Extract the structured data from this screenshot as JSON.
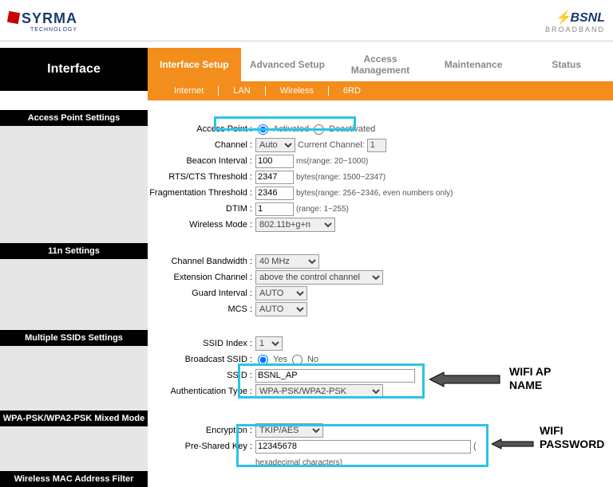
{
  "header": {
    "left_logo": "SYRMA",
    "left_sub": "TECHNOLOGY",
    "right_logo": "BSNL",
    "right_sub": "BROADBAND"
  },
  "nav": {
    "page_title": "Interface",
    "tabs1": [
      "Interface Setup",
      "Advanced Setup",
      "Access Management",
      "Maintenance",
      "Status"
    ],
    "tabs2": [
      "Internet",
      "LAN",
      "Wireless",
      "6RD"
    ]
  },
  "sections": {
    "aps": "Access Point Settings",
    "n11": "11n Settings",
    "mssid": "Multiple SSIDs Settings",
    "wpa": "WPA-PSK/WPA2-PSK Mixed Mode",
    "mac": "Wireless MAC Address Filter"
  },
  "ap": {
    "access_point_label": "Access Point :",
    "activated": "Activated",
    "deactivated": "Deactivated",
    "channel_label": "Channel :",
    "channel_val": "Auto",
    "current_channel": "Current Channel:",
    "current_channel_val": "1",
    "beacon_label": "Beacon Interval :",
    "beacon_val": "100",
    "beacon_hint": "ms(range: 20~1000)",
    "rts_label": "RTS/CTS Threshold :",
    "rts_val": "2347",
    "rts_hint": "bytes(range: 1500~2347)",
    "frag_label": "Fragmentation Threshold :",
    "frag_val": "2346",
    "frag_hint": "bytes(range: 256~2346, even numbers only)",
    "dtim_label": "DTIM :",
    "dtim_val": "1",
    "dtim_hint": "(range: 1~255)",
    "wmode_label": "Wireless Mode :",
    "wmode_val": "802.11b+g+n"
  },
  "n11": {
    "cbw_label": "Channel Bandwidth :",
    "cbw_val": "40 MHz",
    "ext_label": "Extension Channel :",
    "ext_val": "above the control channel",
    "gi_label": "Guard Interval :",
    "gi_val": "AUTO",
    "mcs_label": "MCS :",
    "mcs_val": "AUTO"
  },
  "mssid": {
    "idx_label": "SSID Index :",
    "idx_val": "1",
    "bcast_label": "Broadcast SSID :",
    "yes": "Yes",
    "no": "No",
    "ssid_label": "SSID :",
    "ssid_val": "BSNL_AP",
    "auth_label": "Authentication Type :",
    "auth_val": "WPA-PSK/WPA2-PSK"
  },
  "wpa": {
    "enc_label": "Encryption :",
    "enc_val": "TKIP/AES",
    "psk_label": "Pre-Shared Key :",
    "psk_val": "12345678",
    "psk_hint": "hexadecimal characters)"
  },
  "annot": {
    "aap": "WIFI AP",
    "name": "NAME",
    "wifi": "WIFI",
    "pwd": "PASSWORD"
  }
}
